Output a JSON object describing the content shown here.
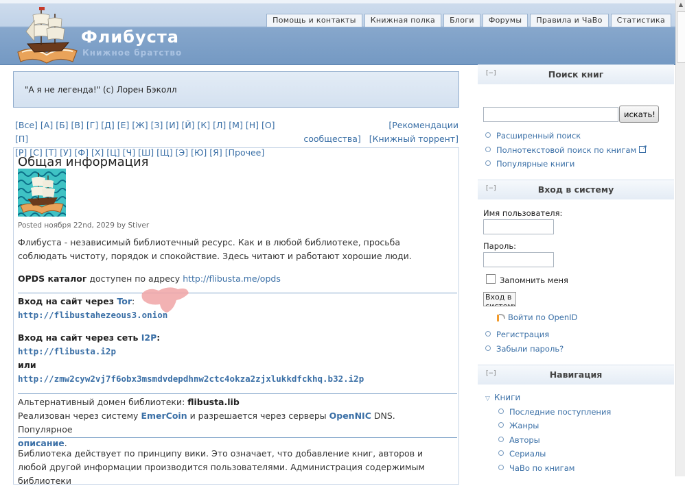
{
  "header": {
    "site_name": "Флибуста",
    "slogan": "Книжное братство",
    "tabs": [
      "Помощь и контакты",
      "Книжная полка",
      "Блоги",
      "Форумы",
      "Правила и ЧаВо",
      "Статистика"
    ]
  },
  "quote": "\"А я не легенда!\" (c) Лорен Бэколл",
  "alphabet": {
    "letters_line1": [
      "[Все]",
      "[А]",
      "[Б]",
      "[В]",
      "[Г]",
      "[Д]",
      "[Е]",
      "[Ж]",
      "[З]",
      "[И]",
      "[Й]",
      "[К]",
      "[Л]",
      "[М]",
      "[Н]",
      "[О]",
      "[П]"
    ],
    "letters_line2": [
      "[Р]",
      "[С]",
      "[Т]",
      "[У]",
      "[Ф]",
      "[Х]",
      "[Ц]",
      "[Ч]",
      "[Ш]",
      "[Щ]",
      "[Э]",
      "[Ю]",
      "[Я]",
      "[Прочее]"
    ],
    "recommend_a": "[Рекомендации",
    "recommend_b": "сообщества]",
    "torrent": "[Книжный торрент]"
  },
  "article": {
    "title": "Общая информация",
    "posted": "Posted ноября 22nd, 2029 by Stiver",
    "intro": "Флибуста - независимый библиотечный ресурс. Как и в любой библиотеке, просьба соблюдать чистоту, порядок и спокойствие. Здесь читают и работают хорошие люди.",
    "opds_label": "OPDS каталог",
    "opds_text": " доступен по адресу ",
    "opds_url": "http://flibusta.me/opds",
    "tor_label": "Вход на сайт через ",
    "tor_link": "Tor",
    "tor_colon": ":",
    "tor_url": "http://flibustahezeous3.onion",
    "i2p_label": "Вход на сайт через сеть ",
    "i2p_link": "I2P",
    "i2p_colon": ":",
    "i2p_url1": "http://flibusta.i2p",
    "or": "или",
    "i2p_url2": "http://zmw2cyw2vj7f6obx3msmdvdepdhnw2ctc4okza2zjxlukkdfckhq.b32.i2p",
    "alt_domain_label": "Альтернативный домен библиотеки: ",
    "alt_domain": "flibusta.lib",
    "alt_text1": "Реализован через систему ",
    "emercoin": "EmerCoin",
    "alt_text2": " и разрешается через серверы ",
    "opennic": "OpenNIC",
    "alt_text3": " DNS. Популярное",
    "description_link": "описание",
    "dot": ".",
    "wiki_text": "Библиотека действует по принципу вики. Это означает, что добавление книг, авторов и любой другой информации производится пользователями. Администрация содержимым библиотеки"
  },
  "sidebar": {
    "search": {
      "title": "Поиск книг",
      "collapse": "[−]",
      "button": "искать!",
      "links": [
        "Расширенный поиск",
        "Полнотекстовой поиск по книгам",
        "Популярные книги"
      ]
    },
    "login": {
      "title": "Вход в систему",
      "collapse": "[−]",
      "username_label": "Имя пользователя:",
      "password_label": "Пароль:",
      "remember": "Запомнить меня",
      "login_button": "Вход в систему",
      "openid": "Войти по OpenID",
      "links": [
        "Регистрация",
        "Забыли пароль?"
      ]
    },
    "nav": {
      "title": "Навигация",
      "collapse": "[−]",
      "root": "Книги",
      "items": [
        "Последние поступления",
        "Жанры",
        "Авторы",
        "Сериалы",
        "ЧаВо по книгам"
      ]
    }
  },
  "colors": {
    "link": "#3a6fa6",
    "header_blue": "#7499c3",
    "rule": "#7ea2c8"
  }
}
